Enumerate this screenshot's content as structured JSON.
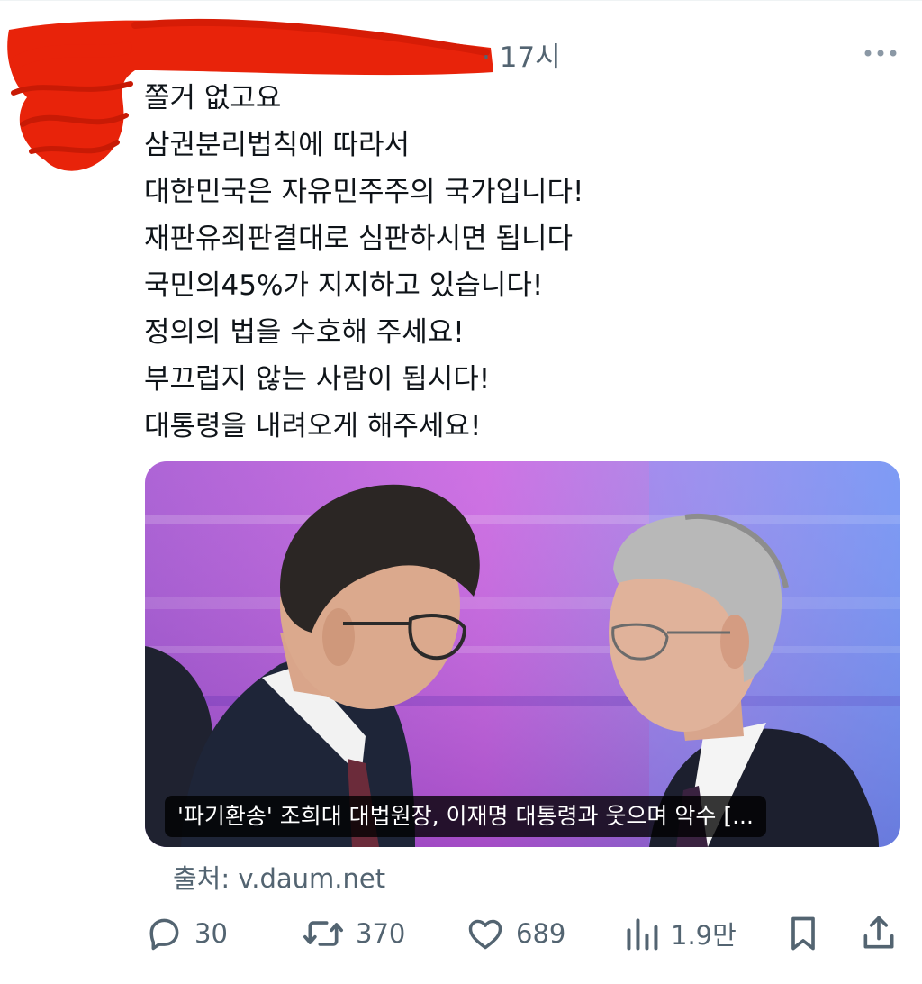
{
  "tweet": {
    "timestamp": "· 17시",
    "lines": [
      "쫄거 없고요",
      "삼권분리법칙에 따라서",
      "대한민국은 자유민주주의 국가입니다!",
      "재판유죄판결대로 심판하시면 됩니다",
      "국민의45%가 지지하고 있습니다!",
      "정의의 법을 수호해 주세요!",
      "부끄럽지 않는 사람이 됩시다!",
      "대통령을 내려오게 해주세요!"
    ]
  },
  "card": {
    "caption": "'파기환송' 조희대 대법원장, 이재명 대통령과 웃으며 악수 [...",
    "source": "출처: v.daum.net"
  },
  "actions": {
    "reply_count": "30",
    "repost_count": "370",
    "like_count": "689",
    "views_count": "1.9만"
  },
  "icons": {
    "more": "more-horizontal-icon",
    "reply": "reply-icon",
    "repost": "repost-icon",
    "like": "heart-icon",
    "views": "views-chart-icon",
    "bookmark": "bookmark-icon",
    "share": "share-icon"
  },
  "colors": {
    "text": "#0f1419",
    "secondary": "#536471",
    "redaction": "#e8230a"
  }
}
